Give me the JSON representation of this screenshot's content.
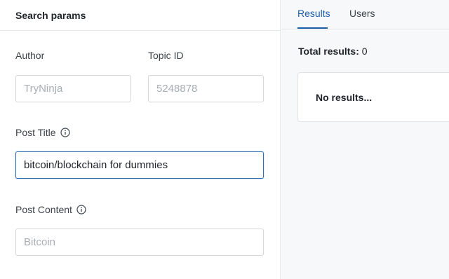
{
  "search": {
    "title": "Search params",
    "author": {
      "label": "Author",
      "value": "",
      "placeholder": "TryNinja"
    },
    "topic_id": {
      "label": "Topic ID",
      "value": "",
      "placeholder": "5248878"
    },
    "post_title": {
      "label": "Post Title",
      "value": "bitcoin/blockchain for dummies",
      "placeholder": ""
    },
    "post_content": {
      "label": "Post Content",
      "value": "",
      "placeholder": "Bitcoin"
    }
  },
  "results_panel": {
    "tabs": [
      {
        "label": "Results",
        "active": true
      },
      {
        "label": "Users",
        "active": false
      }
    ],
    "total_label": "Total results:",
    "total_count": "0",
    "empty_message": "No results..."
  },
  "colors": {
    "accent": "#1d5ea8",
    "focus_border": "#2f6fb0",
    "panel_bg": "#f7f8fa"
  }
}
